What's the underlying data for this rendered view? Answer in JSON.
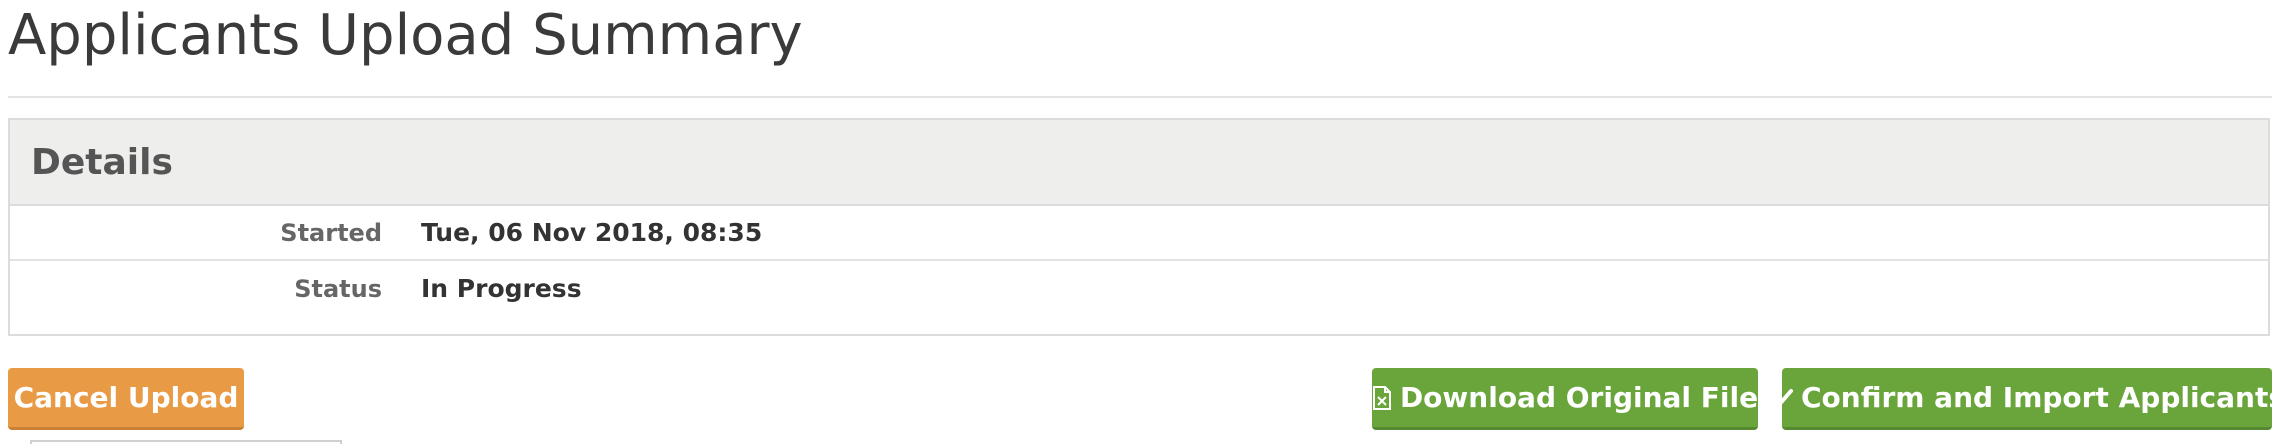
{
  "page": {
    "title": "Applicants Upload Summary"
  },
  "details": {
    "heading": "Details",
    "rows": [
      {
        "label": "Started",
        "value": "Tue, 06 Nov 2018, 08:35"
      },
      {
        "label": "Status",
        "value": "In Progress"
      }
    ]
  },
  "actions": {
    "cancel_label": "Cancel Upload",
    "download_label": "Download Original File",
    "download_icon": "file-excel-icon",
    "confirm_label": "Confirm and Import Applicants",
    "confirm_icon": "checkmark-icon"
  },
  "colors": {
    "cancel_button": "#e99a45",
    "action_button": "#6aa53c",
    "panel_heading_bg": "#eeeeec"
  }
}
